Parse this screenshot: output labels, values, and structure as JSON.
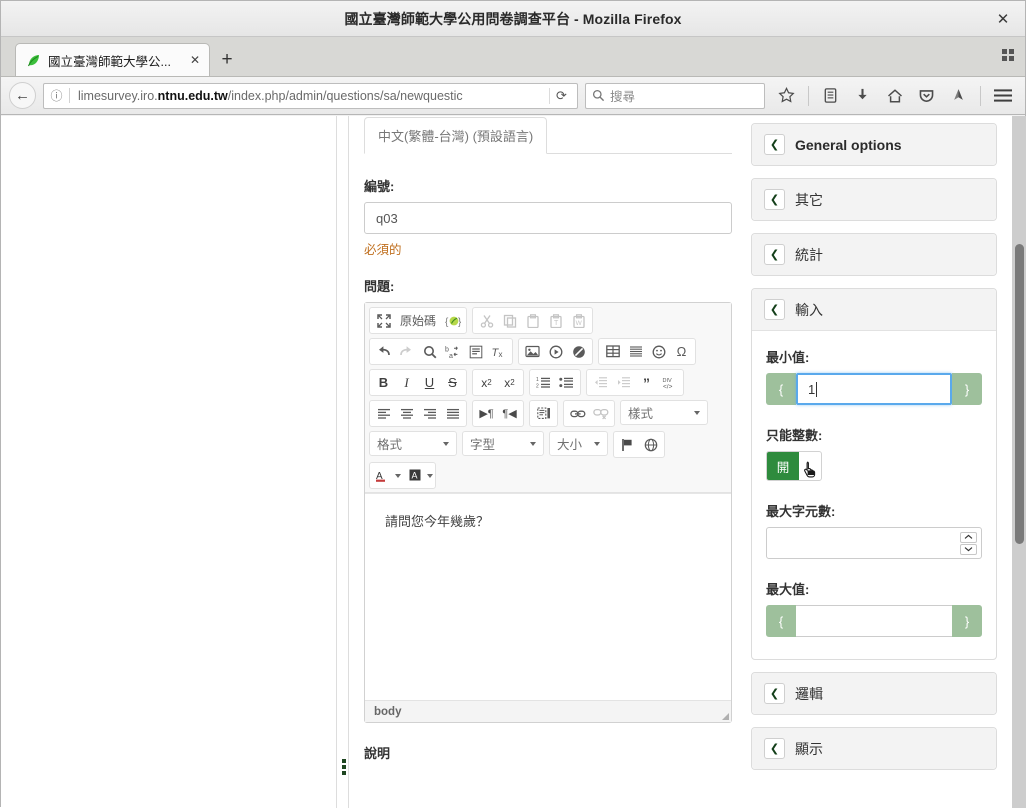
{
  "window": {
    "title": "國立臺灣師範大學公用問卷調查平台 - Mozilla Firefox",
    "close_label": "✕"
  },
  "tabbar": {
    "tabs": [
      {
        "title": "國立臺灣師範大學公...",
        "close_label": "✕",
        "favicon": "limesurvey-leaf-icon"
      }
    ],
    "new_tab_label": "+",
    "list_all_tabs_label": "list-all-tabs-icon"
  },
  "navbar": {
    "back_label": "←",
    "info_label": "ⓘ",
    "url_prefix": "limesurvey.iro.",
    "url_domain": "ntnu.edu.tw",
    "url_path": "/index.php/admin/questions/sa/newquestic",
    "reload_label": "⟳",
    "search_placeholder": "搜尋",
    "icons": [
      "bookmark-star-icon",
      "library-icon",
      "downloads-icon",
      "home-icon",
      "pocket-icon",
      "sync-icon",
      "menu-hamburger-icon"
    ]
  },
  "form": {
    "language_tabs": [
      {
        "label": "中文(繁體-台灣) (預設語言)",
        "active": true
      }
    ],
    "code": {
      "label": "編號:",
      "value": "q03",
      "help": "必須的"
    },
    "question": {
      "label": "問題:",
      "body_text": "請問您今年幾歲？",
      "path": "body"
    },
    "next_label": "說明"
  },
  "editor_toolbar": {
    "groups": [
      {
        "name": "document",
        "buttons": [
          {
            "name": "maximize-icon",
            "glyph": "⤢"
          },
          {
            "name": "source-code-button",
            "glyph": "原始碼"
          },
          {
            "name": "templates-icon",
            "glyph": "{}"
          }
        ]
      },
      {
        "name": "clipboard",
        "buttons": [
          {
            "name": "cut-icon",
            "glyph": "✂",
            "disabled": true
          },
          {
            "name": "copy-icon",
            "glyph": "⧉",
            "disabled": true
          },
          {
            "name": "paste-icon",
            "glyph": "📋",
            "disabled": true
          },
          {
            "name": "paste-text-icon",
            "glyph": "T",
            "disabled": true
          },
          {
            "name": "paste-word-icon",
            "glyph": "W",
            "disabled": true
          }
        ]
      },
      {
        "name": "editing",
        "buttons": [
          {
            "name": "undo-icon",
            "glyph": "↶"
          },
          {
            "name": "redo-icon",
            "glyph": "↷",
            "disabled": true
          },
          {
            "name": "find-icon",
            "glyph": "🔍"
          },
          {
            "name": "replace-icon",
            "glyph": "ba"
          },
          {
            "name": "select-all-icon",
            "glyph": "▤"
          },
          {
            "name": "remove-format-icon",
            "glyph": "Tx"
          }
        ]
      },
      {
        "name": "insert-media",
        "buttons": [
          {
            "name": "image-icon",
            "glyph": "🖼"
          },
          {
            "name": "media-embed-icon",
            "glyph": "▶"
          },
          {
            "name": "flash-icon",
            "glyph": "◍"
          }
        ]
      },
      {
        "name": "insert",
        "buttons": [
          {
            "name": "table-icon",
            "glyph": "▦"
          },
          {
            "name": "horizontal-rule-icon",
            "glyph": "▤"
          },
          {
            "name": "smiley-icon",
            "glyph": "☺"
          },
          {
            "name": "special-char-icon",
            "glyph": "Ω"
          }
        ]
      },
      {
        "name": "basic-styles",
        "buttons": [
          {
            "name": "bold-icon",
            "glyph": "B"
          },
          {
            "name": "italic-icon",
            "glyph": "I"
          },
          {
            "name": "underline-icon",
            "glyph": "U"
          },
          {
            "name": "strikethrough-icon",
            "glyph": "S"
          }
        ]
      },
      {
        "name": "scripts",
        "buttons": [
          {
            "name": "subscript-icon",
            "glyph": "x₂"
          },
          {
            "name": "superscript-icon",
            "glyph": "x²"
          }
        ]
      },
      {
        "name": "lists",
        "buttons": [
          {
            "name": "numbered-list-icon",
            "glyph": "1≡"
          },
          {
            "name": "bulleted-list-icon",
            "glyph": "•≡"
          }
        ]
      },
      {
        "name": "indent",
        "buttons": [
          {
            "name": "outdent-icon",
            "glyph": "⇤",
            "disabled": true
          },
          {
            "name": "indent-icon",
            "glyph": "⇥",
            "disabled": true
          },
          {
            "name": "blockquote-icon",
            "glyph": "❞"
          },
          {
            "name": "create-div-icon",
            "glyph": "DIV"
          }
        ]
      },
      {
        "name": "align",
        "buttons": [
          {
            "name": "align-left-icon",
            "glyph": "≡"
          },
          {
            "name": "align-center-icon",
            "glyph": "≡"
          },
          {
            "name": "align-right-icon",
            "glyph": "≡"
          },
          {
            "name": "justify-icon",
            "glyph": "≡"
          }
        ]
      },
      {
        "name": "bidi",
        "buttons": [
          {
            "name": "text-direction-ltr-icon",
            "glyph": "¶"
          },
          {
            "name": "text-direction-rtl-icon",
            "glyph": "¶"
          }
        ]
      },
      {
        "name": "show-blocks",
        "buttons": [
          {
            "name": "show-blocks-icon",
            "glyph": "▥"
          }
        ]
      },
      {
        "name": "links",
        "buttons": [
          {
            "name": "link-icon",
            "glyph": "🔗"
          },
          {
            "name": "unlink-icon",
            "glyph": "⛓",
            "disabled": true
          }
        ]
      }
    ],
    "combos": [
      {
        "name": "styles-combo",
        "label": "樣式"
      },
      {
        "name": "format-combo",
        "label": "格式"
      },
      {
        "name": "font-combo",
        "label": "字型"
      },
      {
        "name": "size-combo",
        "label": "大小"
      }
    ],
    "extra_groups": [
      {
        "name": "language-tools",
        "buttons": [
          {
            "name": "flag-icon",
            "glyph": "⚑"
          },
          {
            "name": "globe-icon",
            "glyph": "🌐"
          }
        ]
      },
      {
        "name": "colors",
        "buttons": [
          {
            "name": "text-color-icon",
            "glyph": "A"
          },
          {
            "name": "background-color-icon",
            "glyph": "A"
          }
        ]
      }
    ]
  },
  "sidebar": {
    "panels": [
      {
        "name": "general-options",
        "title": "General options",
        "english": true,
        "open": false
      },
      {
        "name": "other",
        "title": "其它",
        "english": false,
        "open": false
      },
      {
        "name": "statistics",
        "title": "統計",
        "english": false,
        "open": false
      },
      {
        "name": "input",
        "title": "輸入",
        "english": false,
        "open": true
      },
      {
        "name": "logic",
        "title": "邏輯",
        "english": false,
        "open": false
      },
      {
        "name": "display",
        "title": "顯示",
        "english": false,
        "open": false
      }
    ],
    "input_panel": {
      "min_value": {
        "label": "最小值:",
        "value": "1",
        "prefix": "{",
        "suffix": "}",
        "focused": true
      },
      "integer_only": {
        "label": "只能整數:",
        "on_label": "開",
        "state": "on"
      },
      "max_chars": {
        "label": "最大字元數:",
        "value": "",
        "spin_up": "⌃",
        "spin_down": "⌄"
      },
      "max_value": {
        "label": "最大值:",
        "value": "",
        "prefix": "{",
        "suffix": "}",
        "focused": false
      }
    }
  },
  "colors": {
    "toggle_on_green": "#2e8b3d",
    "addon_green": "#9ec09c",
    "focus_blue": "#5aa9ec",
    "required_orange": "#c07020",
    "chevron_green": "#14401a"
  }
}
